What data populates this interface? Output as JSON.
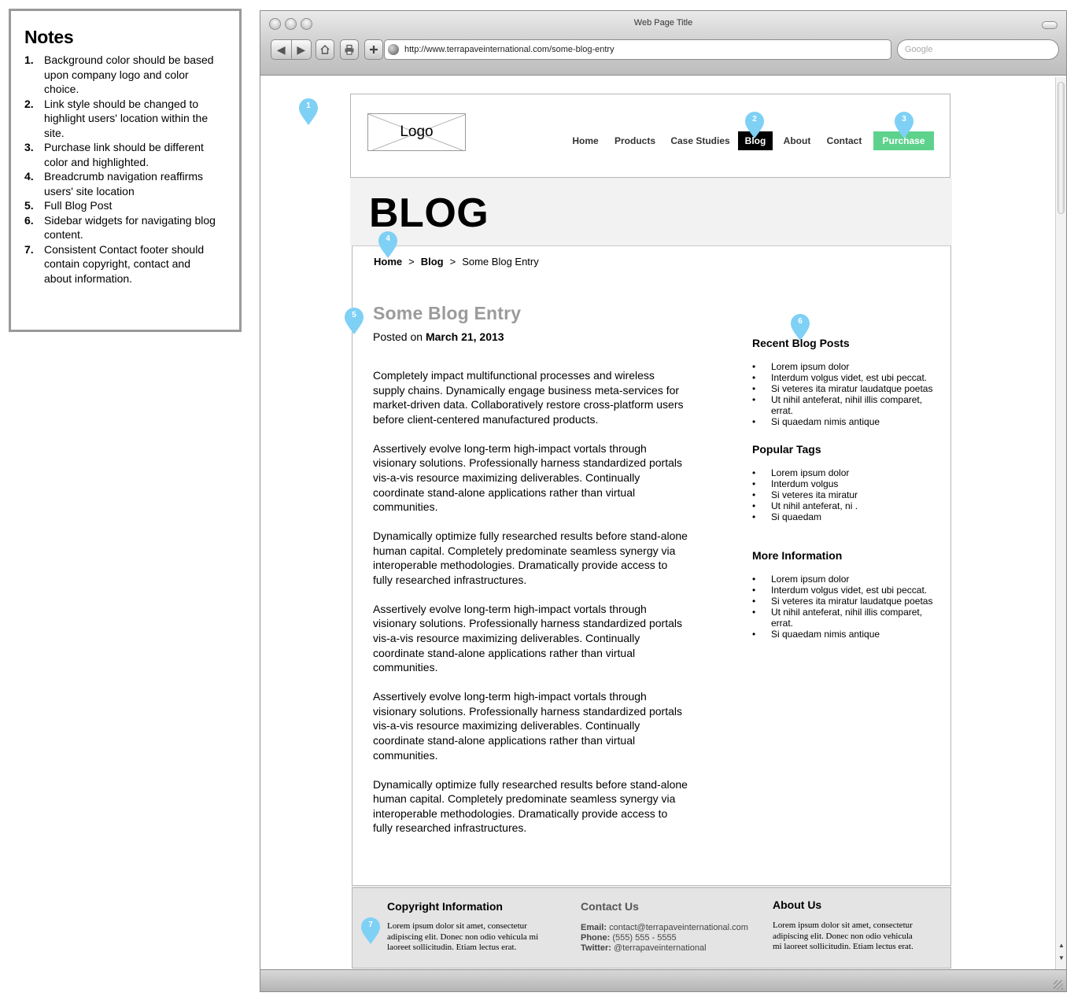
{
  "notes": {
    "title": "Notes",
    "items": [
      {
        "num": "1.",
        "text": "Background color should be based upon company logo and color choice."
      },
      {
        "num": "2.",
        "text": "Link style should be changed to highlight users' location within the site."
      },
      {
        "num": "3.",
        "text": "Purchase link should be different color and highlighted."
      },
      {
        "num": "4.",
        "text": "Breadcrumb navigation reaffirms users' site location"
      },
      {
        "num": "5.",
        "text": "Full Blog Post"
      },
      {
        "num": "6.",
        "text": "Sidebar widgets for navigating blog content."
      },
      {
        "num": "7.",
        "text": "Consistent Contact footer should contain copyright, contact and about information."
      }
    ]
  },
  "browser": {
    "title": "Web Page Title",
    "url": "http://www.terrapaveinternational.com/some-blog-entry",
    "search_placeholder": "Google"
  },
  "site": {
    "logo": "Logo",
    "nav": [
      "Home",
      "Products",
      "Case Studies",
      "Blog",
      "About",
      "Contact",
      "Purchase"
    ],
    "active_nav": "Blog",
    "purchase_color": "#5ed28d",
    "banner_title": "BLOG",
    "breadcrumb": {
      "home": "Home",
      "blog": "Blog",
      "current": "Some Blog Entry",
      "separator": ">"
    }
  },
  "post": {
    "title": "Some Blog Entry",
    "posted_prefix": "Posted on",
    "date": "March 21, 2013",
    "paragraphs": [
      "Completely impact multifunctional processes and wireless supply chains. Dynamically engage business meta-services for market-driven data. Collaboratively restore cross-platform users before client-centered manufactured products.",
      "Assertively evolve long-term high-impact vortals through visionary solutions. Professionally harness standardized portals vis-a-vis resource maximizing deliverables. Continually coordinate stand-alone applications rather than virtual communities.",
      "Dynamically optimize fully researched results before stand-alone human capital. Completely predominate seamless synergy via interoperable methodologies. Dramatically provide access to fully researched infrastructures.",
      "Assertively evolve long-term high-impact vortals through visionary solutions. Professionally harness standardized portals vis-a-vis resource maximizing deliverables. Continually coordinate stand-alone applications rather than virtual communities.",
      "Assertively evolve long-term high-impact vortals through visionary solutions. Professionally harness standardized portals vis-a-vis resource maximizing deliverables. Continually coordinate stand-alone applications rather than virtual communities.",
      "Dynamically optimize fully researched results before stand-alone human capital. Completely predominate seamless synergy via interoperable methodologies. Dramatically provide access to fully researched infrastructures."
    ]
  },
  "sidebar": {
    "recent": {
      "title": "Recent Blog Posts",
      "items": [
        "Lorem ipsum dolor",
        "Interdum volgus videt, est ubi peccat.",
        "Si veteres ita miratur laudatque poetas",
        "Ut nihil anteferat, nihil illis comparet, errat.",
        "Si quaedam nimis antique"
      ]
    },
    "tags": {
      "title": "Popular Tags",
      "items": [
        "Lorem ipsum dolor",
        "Interdum volgus",
        "Si veteres ita miratur",
        "Ut nihil anteferat, ni .",
        "Si quaedam"
      ]
    },
    "more": {
      "title": "More Information",
      "items": [
        "Lorem ipsum dolor",
        "Interdum volgus videt, est ubi peccat.",
        "Si veteres ita miratur laudatque poetas",
        "Ut nihil anteferat, nihil illis comparet, errat.",
        "Si quaedam nimis antique"
      ]
    }
  },
  "footer": {
    "copyright": {
      "title": "Copyright Information",
      "text": "Lorem ipsum dolor sit amet, consectetur adipiscing elit. Donec non odio vehicula mi laoreet sollicitudin. Etiam lectus erat."
    },
    "contact": {
      "title": "Contact Us",
      "email_label": "Email:",
      "email": "contact@terrapaveinternational.com",
      "phone_label": "Phone:",
      "phone": "(555) 555 - 5555",
      "twitter_label": "Twitter:",
      "twitter": "@terrapaveinternational"
    },
    "about": {
      "title": "About Us",
      "text": "Lorem ipsum dolor sit amet, consectetur adipiscing elit. Donec non odio vehicula mi laoreet sollicitudin. Etiam lectus erat."
    }
  },
  "markers": [
    "1",
    "2",
    "3",
    "4",
    "5",
    "6",
    "7"
  ],
  "marker_color": "#7fd0f5"
}
